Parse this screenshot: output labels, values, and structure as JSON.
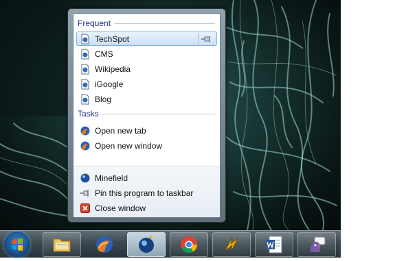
{
  "jumplist": {
    "frequent_header": "Frequent",
    "frequent": [
      {
        "label": "TechSpot",
        "icon": "page-icon",
        "selected": true
      },
      {
        "label": "CMS",
        "icon": "page-icon"
      },
      {
        "label": "Wikipedia",
        "icon": "page-icon"
      },
      {
        "label": "iGoogle",
        "icon": "page-icon"
      },
      {
        "label": "Blog",
        "icon": "page-icon"
      }
    ],
    "tasks_header": "Tasks",
    "tasks": [
      {
        "label": "Open new tab",
        "icon": "firefox-icon"
      },
      {
        "label": "Open new window",
        "icon": "firefox-icon"
      }
    ],
    "footer": [
      {
        "label": "Minefield",
        "icon": "minefield-icon"
      },
      {
        "label": "Pin this program to taskbar",
        "icon": "pin-icon"
      },
      {
        "label": "Close window",
        "icon": "close-icon"
      }
    ]
  },
  "taskbar": {
    "buttons": [
      "start-orb",
      "explorer-icon",
      "firefox-icon",
      "minefield-icon",
      "chrome-icon",
      "winamp-icon",
      "word-icon",
      "pidgin-icon"
    ],
    "active": "minefield-icon"
  },
  "colors": {
    "header_text": "#1e3287",
    "selection_border": "#84acdd",
    "wallpaper": "#163431"
  }
}
